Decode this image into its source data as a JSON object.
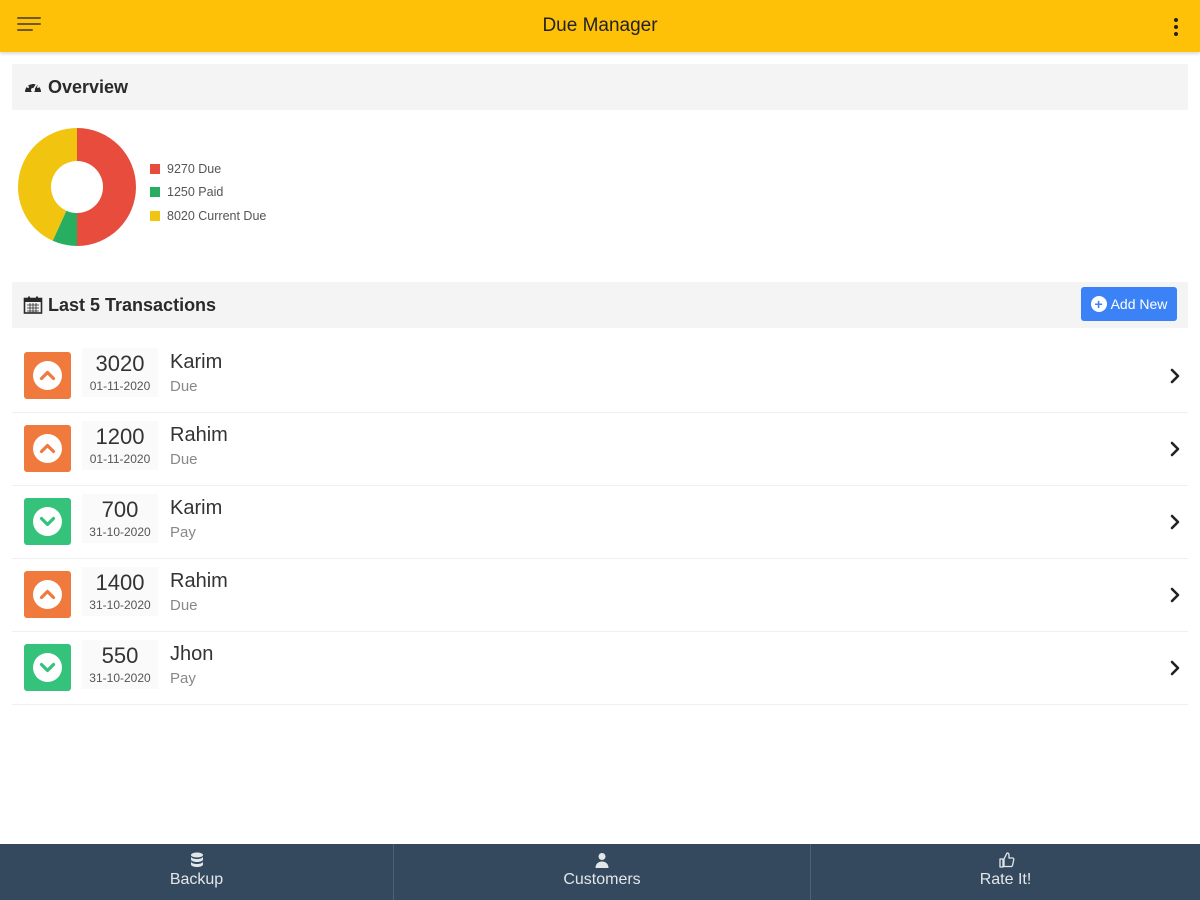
{
  "app": {
    "title": "Due Manager"
  },
  "overview": {
    "title": "Overview",
    "legend": [
      {
        "label": "9270 Due",
        "color": "#e74c3c"
      },
      {
        "label": "1250 Paid",
        "color": "#27ae60"
      },
      {
        "label": "8020 Current Due",
        "color": "#f1c40f"
      }
    ]
  },
  "chart_data": {
    "type": "pie",
    "categories": [
      "Due",
      "Paid",
      "Current Due"
    ],
    "values": [
      9270,
      1250,
      8020
    ],
    "colors": [
      "#e74c3c",
      "#27ae60",
      "#f1c40f"
    ],
    "donut": true
  },
  "transactions": {
    "title": "Last 5 Transactions",
    "add_label": "Add New",
    "items": [
      {
        "amount": "3020",
        "date": "01-11-2020",
        "name": "Karim",
        "type": "Due",
        "kind": "due"
      },
      {
        "amount": "1200",
        "date": "01-11-2020",
        "name": "Rahim",
        "type": "Due",
        "kind": "due"
      },
      {
        "amount": "700",
        "date": "31-10-2020",
        "name": "Karim",
        "type": "Pay",
        "kind": "pay"
      },
      {
        "amount": "1400",
        "date": "31-10-2020",
        "name": "Rahim",
        "type": "Due",
        "kind": "due"
      },
      {
        "amount": "550",
        "date": "31-10-2020",
        "name": "Jhon",
        "type": "Pay",
        "kind": "pay"
      }
    ]
  },
  "bottom_nav": {
    "items": [
      {
        "label": "Backup",
        "icon": "database-icon"
      },
      {
        "label": "Customers",
        "icon": "user-icon"
      },
      {
        "label": "Rate It!",
        "icon": "thumbs-up-icon"
      }
    ]
  }
}
